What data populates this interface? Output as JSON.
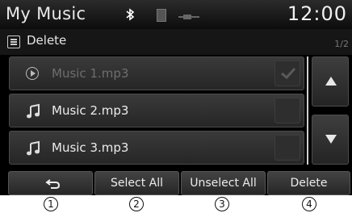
{
  "status_bar": {
    "title": "My Music",
    "clock": "12:00"
  },
  "sub_header": {
    "mode": "Delete",
    "page": "1/2"
  },
  "list": [
    {
      "label": "Music 1.mp3",
      "icon": "play-circle-icon",
      "state": "playing",
      "checked": true
    },
    {
      "label": "Music 2.mp3",
      "icon": "music-note-icon",
      "state": "normal",
      "checked": false
    },
    {
      "label": "Music 3.mp3",
      "icon": "music-note-icon",
      "state": "normal",
      "checked": false
    }
  ],
  "buttons": {
    "back_icon": "back-arrow-icon",
    "select_all": "Select All",
    "unselect_all": "Unselect All",
    "delete": "Delete"
  },
  "callouts": [
    "1",
    "2",
    "3",
    "4"
  ]
}
